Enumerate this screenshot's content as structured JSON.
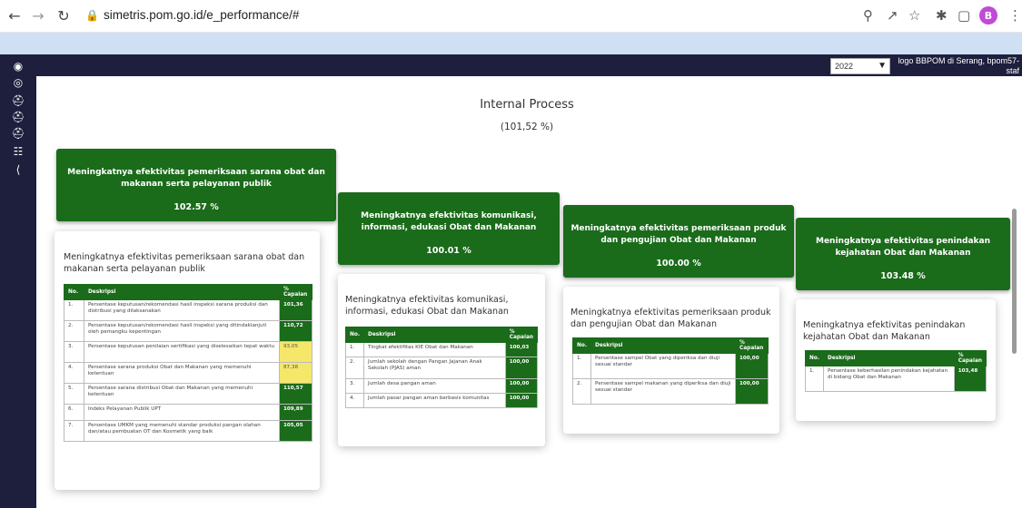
{
  "browser": {
    "url": "simetris.pom.go.id/e_performance/#",
    "profile_letter": "B"
  },
  "appbar": {
    "year": "2022",
    "user_line1": "logo BBPOM di Serang, bpom57-",
    "user_line2": "staf"
  },
  "page": {
    "title": "Internal Process",
    "subtitle": "(101,52 %)"
  },
  "colors": {
    "dark_green": "#1a6b1a",
    "navy": "#1e1e3d",
    "warn_yellow": "#f5e76a"
  },
  "cards": [
    {
      "header_title": "Meningkatnya efektivitas pemeriksaan sarana obat dan makanan serta pelayanan publik",
      "header_pct": "102.57 %",
      "detail_title": "Meningkatnya efektivitas pemeriksaan sarana obat dan makanan serta pelayanan publik",
      "col_no": "No.",
      "col_desc": "Deskripsi",
      "col_pct": "% Capaian",
      "rows": [
        {
          "no": "1.",
          "desc": "Persentase keputusan/rekomendasi hasil inspeksi sarana produksi dan distribusi yang dilaksanakan",
          "val": "101,36",
          "warn": false
        },
        {
          "no": "2.",
          "desc": "Persentase keputusan/rekomendasi hasil inspeksi yang ditindaklanjuti oleh pemangku kepentingan",
          "val": "110,72",
          "warn": false
        },
        {
          "no": "3.",
          "desc": "Persentase keputusan penilaian sertifikasi yang diselesaikan tepat waktu",
          "val": "93,05",
          "warn": true
        },
        {
          "no": "4.",
          "desc": "Persentase sarana produksi Obat dan Makanan yang memenuhi ketentuan",
          "val": "87,38",
          "warn": true
        },
        {
          "no": "5.",
          "desc": "Persentase sarana distribusi Obat dan Makanan yang memenuhi ketentuan",
          "val": "110,57",
          "warn": false
        },
        {
          "no": "6.",
          "desc": "Indeks Pelayanan Publik UPT",
          "val": "109,89",
          "warn": false
        },
        {
          "no": "7.",
          "desc": "Persentase UMKM yang memenuhi standar produksi pangan olahan dan/atau pembuatan OT dan Kosmetik yang baik",
          "val": "105,05",
          "warn": false
        }
      ]
    },
    {
      "header_title": "Meningkatnya efektivitas komunikasi, informasi, edukasi Obat dan Makanan",
      "header_pct": "100.01 %",
      "detail_title": "Meningkatnya efektivitas komunikasi, informasi, edukasi Obat dan Makanan",
      "col_no": "No.",
      "col_desc": "Deskripsi",
      "col_pct": "% Capaian",
      "rows": [
        {
          "no": "1.",
          "desc": "Tingkat efektifitas KIE Obat dan Makanan",
          "val": "100,03",
          "warn": false
        },
        {
          "no": "2.",
          "desc": "Jumlah sekolah dengan Pangan Jajanan Anak Sekolah (PJAS) aman",
          "val": "100,00",
          "warn": false
        },
        {
          "no": "3.",
          "desc": "Jumlah desa pangan aman",
          "val": "100,00",
          "warn": false
        },
        {
          "no": "4.",
          "desc": "Jumlah pasar pangan aman berbasis komunitas",
          "val": "100,00",
          "warn": false
        }
      ]
    },
    {
      "header_title": "Meningkatnya efektivitas pemeriksaan produk dan pengujian Obat dan Makanan",
      "header_pct": "100.00 %",
      "detail_title": "Meningkatnya efektivitas pemeriksaan produk dan pengujian Obat dan Makanan",
      "col_no": "No.",
      "col_desc": "Deskripsi",
      "col_pct": "% Capaian",
      "rows": [
        {
          "no": "1.",
          "desc": "Persentase sampel Obat yang diperiksa dan diuji sesuai standar",
          "val": "100,00",
          "warn": false
        },
        {
          "no": "2.",
          "desc": "Persentase sampel makanan yang diperiksa dan diuji sesuai standar",
          "val": "100,00",
          "warn": false
        }
      ]
    },
    {
      "header_title": "Meningkatnya efektivitas penindakan kejahatan Obat dan Makanan",
      "header_pct": "103.48 %",
      "detail_title": "Meningkatnya efektivitas penindakan kejahatan Obat dan Makanan",
      "col_no": "No.",
      "col_desc": "Deskripsi",
      "col_pct": "% Capaian",
      "rows": [
        {
          "no": "1.",
          "desc": "Persentase keberhasilan penindakan kejahatan di bidang Obat dan Makanan",
          "val": "103,48",
          "warn": false
        }
      ]
    }
  ]
}
